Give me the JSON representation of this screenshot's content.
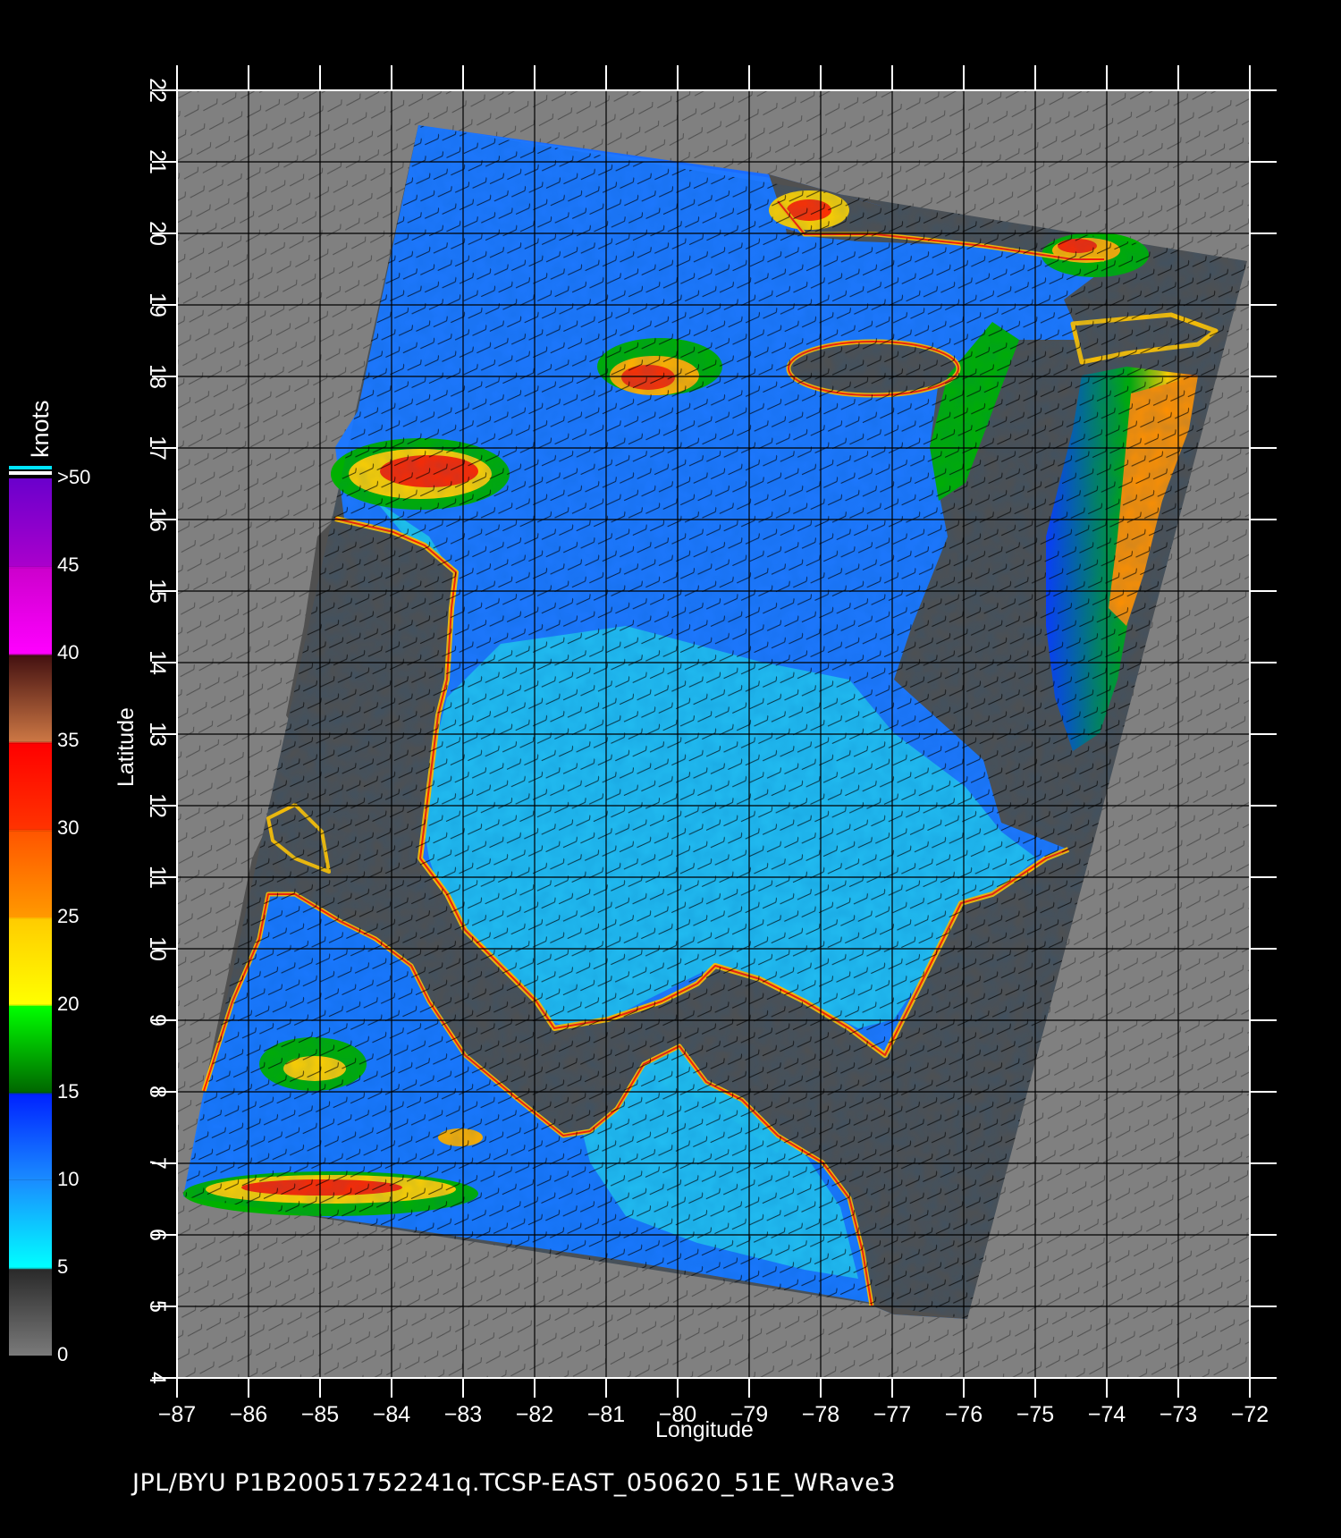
{
  "plot": {
    "footer": "JPL/BYU  P1B20051752241q.TCSP-EAST_050620_51E_WRave3",
    "xlabel": "Longitude",
    "ylabel": "Latitude",
    "lon_range": [
      -87,
      -72
    ],
    "lat_range": [
      4,
      22
    ],
    "lon_ticks": [
      "−87",
      "−86",
      "−85",
      "−84",
      "−83",
      "−82",
      "−81",
      "−80",
      "−79",
      "−78",
      "−77",
      "−76",
      "−75",
      "−74",
      "−73",
      "−72"
    ],
    "lat_ticks": [
      "4",
      "5",
      "6",
      "7",
      "8",
      "9",
      "10",
      "11",
      "12",
      "13",
      "14",
      "15",
      "16",
      "17",
      "18",
      "19",
      "20",
      "21",
      "22"
    ],
    "grid": true,
    "background_color": "#000000",
    "outside_swath_color": "#808080",
    "land_color": "#505050"
  },
  "colorbar": {
    "units": "knots",
    "labels": [
      {
        "text": "0",
        "value": 0
      },
      {
        "text": "5",
        "value": 5
      },
      {
        "text": "10",
        "value": 10
      },
      {
        "text": "15",
        "value": 15
      },
      {
        "text": "20",
        "value": 20
      },
      {
        "text": "25",
        "value": 25
      },
      {
        "text": "30",
        "value": 30
      },
      {
        "text": "35",
        "value": 35
      },
      {
        "text": "40",
        "value": 40
      },
      {
        "text": "45",
        "value": 45
      },
      {
        "text": ">50",
        "value": 50
      }
    ],
    "stops": [
      {
        "value": 0,
        "color": "#7a7a7a"
      },
      {
        "value": 4.9,
        "color": "#2a2a2a"
      },
      {
        "value": 5,
        "color": "#00ffff"
      },
      {
        "value": 10,
        "color": "#1a8cff"
      },
      {
        "value": 14.9,
        "color": "#0022ff"
      },
      {
        "value": 15,
        "color": "#006600"
      },
      {
        "value": 19.9,
        "color": "#00ff00"
      },
      {
        "value": 20,
        "color": "#ffff00"
      },
      {
        "value": 24.9,
        "color": "#ffcc00"
      },
      {
        "value": 25,
        "color": "#ff9900"
      },
      {
        "value": 29.9,
        "color": "#ff5500"
      },
      {
        "value": 30,
        "color": "#ff3300"
      },
      {
        "value": 34.9,
        "color": "#ff0000"
      },
      {
        "value": 35,
        "color": "#cc7744"
      },
      {
        "value": 39.9,
        "color": "#441111"
      },
      {
        "value": 40,
        "color": "#ff00ff"
      },
      {
        "value": 44.9,
        "color": "#cc00cc"
      },
      {
        "value": 45,
        "color": "#aa00cc"
      },
      {
        "value": 50,
        "color": "#6a00cc"
      }
    ]
  }
}
